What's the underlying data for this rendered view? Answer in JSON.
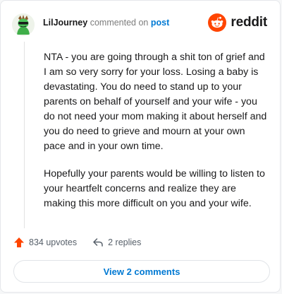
{
  "header": {
    "username": "LilJourney",
    "action_text": "commented on",
    "post_link": "post",
    "brand_name": "reddit"
  },
  "comment": {
    "paragraphs": [
      "NTA - you are going through a shit ton of grief and I am so very sorry for your loss. Losing a baby is devastating. You do need to stand up to your parents on behalf of yourself and your wife - you do not need your mom making it about herself and you do need to grieve and mourn at your own pace and in your own time.",
      "Hopefully your parents would be willing to listen to your heartfelt concerns and realize they are making this more difficult on you and your wife."
    ]
  },
  "footer": {
    "upvotes": "834 upvotes",
    "replies": "2 replies"
  },
  "view_button": {
    "label": "View 2 comments"
  },
  "colors": {
    "reddit_orange": "#ff4500",
    "link_blue": "#0079d3"
  },
  "icons": [
    "avatar",
    "reddit-logo-icon",
    "upvote-arrow-icon",
    "reply-icon"
  ]
}
